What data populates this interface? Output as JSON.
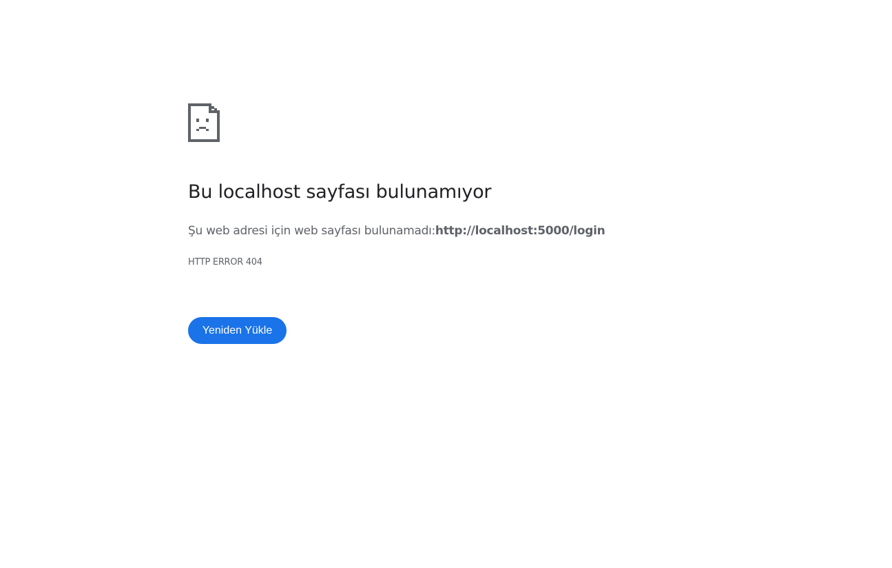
{
  "icon": {
    "name": "sad-page-icon",
    "color": "#5f6368"
  },
  "error": {
    "heading": "Bu localhost sayfası bulunamıyor",
    "message_prefix": "Şu web adresi için web sayfası bulunamadı:",
    "url": "http://localhost:5000/login",
    "code": "HTTP ERROR 404"
  },
  "actions": {
    "reload_label": "Yeniden Yükle",
    "reload_color": "#1a73e8"
  }
}
